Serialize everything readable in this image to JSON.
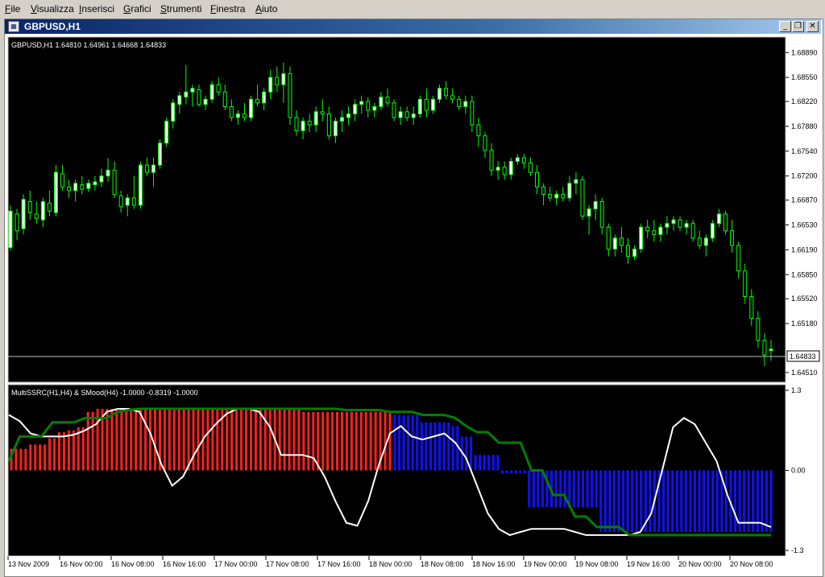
{
  "menu": [
    {
      "label": "File",
      "u": "F",
      "rest": "ile"
    },
    {
      "label": "Visualizza",
      "u": "V",
      "rest": "isualizza"
    },
    {
      "label": "Inserisci",
      "u": "I",
      "rest": "nserisci"
    },
    {
      "label": "Grafici",
      "u": "G",
      "rest": "rafici"
    },
    {
      "label": "Strumenti",
      "u": "S",
      "rest": "trumenti"
    },
    {
      "label": "Finestra",
      "u": "F",
      "rest": "inestra"
    },
    {
      "label": "Aiuto",
      "u": "A",
      "rest": "iuto"
    }
  ],
  "window": {
    "title": "GBPUSD,H1",
    "minimize": "_",
    "restore": "❐",
    "close": "✕"
  },
  "colors": {
    "bg": "#000000",
    "bull": "#ffffff",
    "wick": "#00ff00",
    "red": "#ff2020",
    "blue": "#1010ff",
    "line_white": "#ffffff",
    "line_green": "#008000",
    "axis_text": "#000000",
    "grid": "#c0c0c0"
  },
  "price_panel": {
    "header": "GBPUSD,H1  1.64810 1.64961 1.64668 1.64833",
    "current_price": "1.64833",
    "y_ticks": [
      "1.68890",
      "1.68550",
      "1.68220",
      "1.67880",
      "1.67540",
      "1.67200",
      "1.66870",
      "1.66530",
      "1.66190",
      "1.65850",
      "1.65520",
      "1.65180",
      "1.64510"
    ]
  },
  "indicator_panel": {
    "header": "MultiSSRC(H1,H4) & SMood(H4)  -1.0000 -0.8319 -1.0000",
    "y_ticks": [
      "1.3",
      "0.00",
      "-1.3"
    ]
  },
  "x_ticks": [
    "13 Nov 2009",
    "16 Nov 00:00",
    "16 Nov 08:00",
    "16 Nov 16:00",
    "17 Nov 00:00",
    "17 Nov 08:00",
    "17 Nov 16:00",
    "18 Nov 00:00",
    "18 Nov 08:00",
    "18 Nov 16:00",
    "19 Nov 00:00",
    "19 Nov 08:00",
    "19 Nov 16:00",
    "20 Nov 00:00",
    "20 Nov 08:00"
  ],
  "chart_data": {
    "type": "candlestick",
    "price_range": [
      1.6441,
      1.6897
    ],
    "candles": [
      {
        "o": 1.6622,
        "h": 1.668,
        "l": 1.6618,
        "c": 1.6672
      },
      {
        "o": 1.6668,
        "h": 1.6675,
        "l": 1.6632,
        "c": 1.6645
      },
      {
        "o": 1.6648,
        "h": 1.6695,
        "l": 1.664,
        "c": 1.6688
      },
      {
        "o": 1.6685,
        "h": 1.67,
        "l": 1.666,
        "c": 1.667
      },
      {
        "o": 1.6668,
        "h": 1.6685,
        "l": 1.6655,
        "c": 1.6662
      },
      {
        "o": 1.666,
        "h": 1.669,
        "l": 1.665,
        "c": 1.6685
      },
      {
        "o": 1.6683,
        "h": 1.67,
        "l": 1.6665,
        "c": 1.6672
      },
      {
        "o": 1.667,
        "h": 1.6735,
        "l": 1.6665,
        "c": 1.6725
      },
      {
        "o": 1.6723,
        "h": 1.6735,
        "l": 1.67,
        "c": 1.6705
      },
      {
        "o": 1.6705,
        "h": 1.6715,
        "l": 1.669,
        "c": 1.67
      },
      {
        "o": 1.67,
        "h": 1.6715,
        "l": 1.6685,
        "c": 1.671
      },
      {
        "o": 1.6708,
        "h": 1.672,
        "l": 1.6695,
        "c": 1.6702
      },
      {
        "o": 1.6703,
        "h": 1.6715,
        "l": 1.6698,
        "c": 1.671
      },
      {
        "o": 1.6708,
        "h": 1.672,
        "l": 1.67,
        "c": 1.6712
      },
      {
        "o": 1.6712,
        "h": 1.673,
        "l": 1.6705,
        "c": 1.672
      },
      {
        "o": 1.672,
        "h": 1.6745,
        "l": 1.6712,
        "c": 1.6728
      },
      {
        "o": 1.6728,
        "h": 1.674,
        "l": 1.669,
        "c": 1.6695
      },
      {
        "o": 1.6693,
        "h": 1.67,
        "l": 1.667,
        "c": 1.6678
      },
      {
        "o": 1.668,
        "h": 1.6695,
        "l": 1.6665,
        "c": 1.669
      },
      {
        "o": 1.669,
        "h": 1.672,
        "l": 1.6675,
        "c": 1.668
      },
      {
        "o": 1.668,
        "h": 1.674,
        "l": 1.6675,
        "c": 1.6735
      },
      {
        "o": 1.6735,
        "h": 1.6745,
        "l": 1.672,
        "c": 1.6725
      },
      {
        "o": 1.6725,
        "h": 1.6745,
        "l": 1.6705,
        "c": 1.6735
      },
      {
        "o": 1.6735,
        "h": 1.677,
        "l": 1.673,
        "c": 1.6765
      },
      {
        "o": 1.6765,
        "h": 1.68,
        "l": 1.676,
        "c": 1.6795
      },
      {
        "o": 1.6795,
        "h": 1.6825,
        "l": 1.6785,
        "c": 1.682
      },
      {
        "o": 1.6818,
        "h": 1.6835,
        "l": 1.6805,
        "c": 1.683
      },
      {
        "o": 1.6828,
        "h": 1.6872,
        "l": 1.6818,
        "c": 1.6835
      },
      {
        "o": 1.6835,
        "h": 1.6845,
        "l": 1.6815,
        "c": 1.684
      },
      {
        "o": 1.6838,
        "h": 1.6845,
        "l": 1.6815,
        "c": 1.6818
      },
      {
        "o": 1.6818,
        "h": 1.683,
        "l": 1.681,
        "c": 1.6825
      },
      {
        "o": 1.6825,
        "h": 1.685,
        "l": 1.682,
        "c": 1.6845
      },
      {
        "o": 1.6845,
        "h": 1.6855,
        "l": 1.683,
        "c": 1.6835
      },
      {
        "o": 1.6835,
        "h": 1.6845,
        "l": 1.681,
        "c": 1.6815
      },
      {
        "o": 1.6815,
        "h": 1.6825,
        "l": 1.6795,
        "c": 1.68
      },
      {
        "o": 1.68,
        "h": 1.681,
        "l": 1.679,
        "c": 1.6805
      },
      {
        "o": 1.6805,
        "h": 1.682,
        "l": 1.6795,
        "c": 1.68
      },
      {
        "o": 1.68,
        "h": 1.683,
        "l": 1.6795,
        "c": 1.6825
      },
      {
        "o": 1.6825,
        "h": 1.6845,
        "l": 1.6815,
        "c": 1.682
      },
      {
        "o": 1.682,
        "h": 1.684,
        "l": 1.681,
        "c": 1.6835
      },
      {
        "o": 1.6835,
        "h": 1.6865,
        "l": 1.6825,
        "c": 1.6855
      },
      {
        "o": 1.6855,
        "h": 1.687,
        "l": 1.6835,
        "c": 1.6845
      },
      {
        "o": 1.6845,
        "h": 1.6875,
        "l": 1.682,
        "c": 1.686
      },
      {
        "o": 1.686,
        "h": 1.687,
        "l": 1.679,
        "c": 1.68
      },
      {
        "o": 1.68,
        "h": 1.681,
        "l": 1.6775,
        "c": 1.6782
      },
      {
        "o": 1.6782,
        "h": 1.68,
        "l": 1.677,
        "c": 1.6795
      },
      {
        "o": 1.6795,
        "h": 1.6805,
        "l": 1.678,
        "c": 1.679
      },
      {
        "o": 1.679,
        "h": 1.6815,
        "l": 1.678,
        "c": 1.6808
      },
      {
        "o": 1.6808,
        "h": 1.6825,
        "l": 1.6795,
        "c": 1.6805
      },
      {
        "o": 1.6805,
        "h": 1.6815,
        "l": 1.677,
        "c": 1.6775
      },
      {
        "o": 1.6775,
        "h": 1.68,
        "l": 1.6765,
        "c": 1.6795
      },
      {
        "o": 1.6795,
        "h": 1.681,
        "l": 1.678,
        "c": 1.68
      },
      {
        "o": 1.68,
        "h": 1.6815,
        "l": 1.679,
        "c": 1.6805
      },
      {
        "o": 1.6805,
        "h": 1.6825,
        "l": 1.6795,
        "c": 1.6818
      },
      {
        "o": 1.6818,
        "h": 1.683,
        "l": 1.6805,
        "c": 1.6822
      },
      {
        "o": 1.6822,
        "h": 1.6828,
        "l": 1.68,
        "c": 1.681
      },
      {
        "o": 1.681,
        "h": 1.682,
        "l": 1.68,
        "c": 1.6815
      },
      {
        "o": 1.6815,
        "h": 1.6835,
        "l": 1.681,
        "c": 1.6828
      },
      {
        "o": 1.6828,
        "h": 1.684,
        "l": 1.6815,
        "c": 1.682
      },
      {
        "o": 1.682,
        "h": 1.6825,
        "l": 1.6795,
        "c": 1.68
      },
      {
        "o": 1.68,
        "h": 1.6815,
        "l": 1.679,
        "c": 1.6808
      },
      {
        "o": 1.6808,
        "h": 1.6815,
        "l": 1.6795,
        "c": 1.68
      },
      {
        "o": 1.68,
        "h": 1.6815,
        "l": 1.679,
        "c": 1.6805
      },
      {
        "o": 1.6805,
        "h": 1.683,
        "l": 1.68,
        "c": 1.6825
      },
      {
        "o": 1.6825,
        "h": 1.684,
        "l": 1.68,
        "c": 1.681
      },
      {
        "o": 1.681,
        "h": 1.683,
        "l": 1.6805,
        "c": 1.6825
      },
      {
        "o": 1.6825,
        "h": 1.6845,
        "l": 1.682,
        "c": 1.684
      },
      {
        "o": 1.684,
        "h": 1.685,
        "l": 1.6825,
        "c": 1.683
      },
      {
        "o": 1.683,
        "h": 1.684,
        "l": 1.682,
        "c": 1.6825
      },
      {
        "o": 1.6825,
        "h": 1.683,
        "l": 1.681,
        "c": 1.6815
      },
      {
        "o": 1.6815,
        "h": 1.683,
        "l": 1.6805,
        "c": 1.6822
      },
      {
        "o": 1.6822,
        "h": 1.683,
        "l": 1.678,
        "c": 1.679
      },
      {
        "o": 1.679,
        "h": 1.68,
        "l": 1.676,
        "c": 1.6775
      },
      {
        "o": 1.6775,
        "h": 1.678,
        "l": 1.6745,
        "c": 1.6755
      },
      {
        "o": 1.6755,
        "h": 1.6765,
        "l": 1.672,
        "c": 1.6728
      },
      {
        "o": 1.6728,
        "h": 1.674,
        "l": 1.6715,
        "c": 1.6732
      },
      {
        "o": 1.6732,
        "h": 1.674,
        "l": 1.6715,
        "c": 1.6722
      },
      {
        "o": 1.6722,
        "h": 1.6745,
        "l": 1.6715,
        "c": 1.674
      },
      {
        "o": 1.674,
        "h": 1.675,
        "l": 1.6735,
        "c": 1.6745
      },
      {
        "o": 1.6745,
        "h": 1.675,
        "l": 1.673,
        "c": 1.6738
      },
      {
        "o": 1.6738,
        "h": 1.6745,
        "l": 1.672,
        "c": 1.6725
      },
      {
        "o": 1.6725,
        "h": 1.6735,
        "l": 1.6695,
        "c": 1.6705
      },
      {
        "o": 1.6705,
        "h": 1.671,
        "l": 1.668,
        "c": 1.6695
      },
      {
        "o": 1.6695,
        "h": 1.6705,
        "l": 1.6685,
        "c": 1.669
      },
      {
        "o": 1.669,
        "h": 1.67,
        "l": 1.668,
        "c": 1.6695
      },
      {
        "o": 1.6695,
        "h": 1.6705,
        "l": 1.6685,
        "c": 1.669
      },
      {
        "o": 1.669,
        "h": 1.672,
        "l": 1.6685,
        "c": 1.671
      },
      {
        "o": 1.671,
        "h": 1.6725,
        "l": 1.6695,
        "c": 1.6715
      },
      {
        "o": 1.6715,
        "h": 1.672,
        "l": 1.666,
        "c": 1.6665
      },
      {
        "o": 1.6665,
        "h": 1.668,
        "l": 1.664,
        "c": 1.6675
      },
      {
        "o": 1.6675,
        "h": 1.6695,
        "l": 1.666,
        "c": 1.6685
      },
      {
        "o": 1.6685,
        "h": 1.669,
        "l": 1.664,
        "c": 1.665
      },
      {
        "o": 1.665,
        "h": 1.6655,
        "l": 1.661,
        "c": 1.662
      },
      {
        "o": 1.662,
        "h": 1.664,
        "l": 1.661,
        "c": 1.6635
      },
      {
        "o": 1.6635,
        "h": 1.665,
        "l": 1.6615,
        "c": 1.6625
      },
      {
        "o": 1.6625,
        "h": 1.6635,
        "l": 1.66,
        "c": 1.661
      },
      {
        "o": 1.661,
        "h": 1.6625,
        "l": 1.6605,
        "c": 1.662
      },
      {
        "o": 1.662,
        "h": 1.6655,
        "l": 1.6615,
        "c": 1.665
      },
      {
        "o": 1.665,
        "h": 1.666,
        "l": 1.6635,
        "c": 1.6645
      },
      {
        "o": 1.6645,
        "h": 1.666,
        "l": 1.663,
        "c": 1.664
      },
      {
        "o": 1.664,
        "h": 1.6655,
        "l": 1.663,
        "c": 1.665
      },
      {
        "o": 1.665,
        "h": 1.6665,
        "l": 1.664,
        "c": 1.6655
      },
      {
        "o": 1.6655,
        "h": 1.6665,
        "l": 1.6645,
        "c": 1.666
      },
      {
        "o": 1.666,
        "h": 1.6665,
        "l": 1.6645,
        "c": 1.665
      },
      {
        "o": 1.665,
        "h": 1.666,
        "l": 1.664,
        "c": 1.6655
      },
      {
        "o": 1.6655,
        "h": 1.666,
        "l": 1.663,
        "c": 1.6635
      },
      {
        "o": 1.6635,
        "h": 1.6645,
        "l": 1.662,
        "c": 1.6625
      },
      {
        "o": 1.6625,
        "h": 1.664,
        "l": 1.661,
        "c": 1.6635
      },
      {
        "o": 1.6635,
        "h": 1.666,
        "l": 1.663,
        "c": 1.6655
      },
      {
        "o": 1.6655,
        "h": 1.6675,
        "l": 1.665,
        "c": 1.6668
      },
      {
        "o": 1.6668,
        "h": 1.6672,
        "l": 1.664,
        "c": 1.6645
      },
      {
        "o": 1.6645,
        "h": 1.666,
        "l": 1.6615,
        "c": 1.6625
      },
      {
        "o": 1.6625,
        "h": 1.663,
        "l": 1.658,
        "c": 1.659
      },
      {
        "o": 1.659,
        "h": 1.66,
        "l": 1.6545,
        "c": 1.6555
      },
      {
        "o": 1.6555,
        "h": 1.6565,
        "l": 1.6515,
        "c": 1.6525
      },
      {
        "o": 1.6525,
        "h": 1.6535,
        "l": 1.6485,
        "c": 1.6495
      },
      {
        "o": 1.6495,
        "h": 1.6505,
        "l": 1.646,
        "c": 1.6475
      },
      {
        "o": 1.6481,
        "h": 1.6496,
        "l": 1.6467,
        "c": 1.6483
      }
    ],
    "indicator_range": [
      -1.3,
      1.3
    ],
    "indicator_histogram": [
      0.35,
      0.35,
      0.35,
      0.35,
      0.42,
      0.42,
      0.42,
      0.42,
      0.52,
      0.52,
      0.62,
      0.62,
      0.65,
      0.65,
      0.7,
      0.7,
      0.95,
      0.95,
      1.0,
      1.0,
      1.0,
      1.0,
      1.0,
      1.0,
      1.0,
      1.0,
      1.0,
      1.0,
      1.0,
      1.0,
      1.0,
      1.0,
      1.0,
      1.0,
      1.0,
      1.0,
      1.0,
      1.0,
      1.0,
      1.0,
      1.0,
      1.0,
      1.0,
      1.0,
      1.0,
      1.0,
      1.0,
      1.0,
      1.0,
      1.0,
      1.0,
      1.0,
      1.0,
      1.0,
      1.0,
      1.0,
      1.0,
      1.0,
      1.0,
      1.0,
      1.0,
      0.95,
      0.95,
      0.95,
      0.95,
      0.95,
      0.95,
      0.95,
      0.95,
      0.95,
      0.95,
      0.95,
      0.95,
      0.95,
      0.95,
      0.95,
      0.95,
      0.95,
      0.95,
      0.95,
      0.95,
      0.95,
      0.95,
      0.95,
      0.95,
      0.95,
      0.95,
      0.95,
      0.95,
      0.95,
      0.95,
      0.95,
      0.95,
      0.95,
      0.95,
      0.95,
      0.95,
      0.95,
      0.95,
      0.95,
      0.95,
      0.95,
      0.95,
      0.95,
      0.95,
      0.95,
      0.95,
      0.95,
      0.95,
      0.95,
      0.95,
      0.95,
      0.95,
      0.95,
      0.95,
      0.95,
      0.95,
      0.95,
      0.95,
      0.95,
      0.95,
      0.95,
      0.95,
      0.95,
      0.95
    ],
    "indicator_colors": [
      "r",
      "r",
      "r",
      "r",
      "r",
      "r",
      "r",
      "r",
      "r",
      "r",
      "r",
      "r",
      "r",
      "r",
      "r",
      "r",
      "r",
      "r",
      "r",
      "r",
      "r",
      "r",
      "r",
      "r",
      "r",
      "r",
      "r",
      "r",
      "r",
      "r",
      "r",
      "r",
      "r",
      "r",
      "r",
      "r",
      "r",
      "r",
      "r",
      "r",
      "r",
      "r",
      "r",
      "r",
      "r",
      "r",
      "r",
      "r",
      "r",
      "r",
      "r",
      "r",
      "r",
      "r",
      "r",
      "r",
      "r",
      "r",
      "r",
      "r",
      "r",
      "r",
      "r",
      "r",
      "r",
      "r",
      "r",
      "r",
      "r",
      "r",
      "r",
      "r",
      "r",
      "r",
      "r",
      "r",
      "r",
      "r",
      "r",
      "r",
      "r",
      "r",
      "r",
      "r",
      "r",
      "r",
      "r",
      "r",
      "r",
      "r",
      "r",
      "r",
      "r",
      "r",
      "r",
      "r",
      "r",
      "r",
      "r",
      "r",
      "r",
      "r",
      "r",
      "r",
      "r",
      "r",
      "r",
      "r",
      "r",
      "r",
      "r",
      "r",
      "r",
      "r",
      "r",
      "r",
      "r",
      "r",
      "r",
      "r",
      "r"
    ],
    "blue_histogram": [
      0.9,
      0.9,
      0.9,
      0.9,
      0.9,
      0.9,
      0.78,
      0.78,
      0.78,
      0.78,
      0.78,
      0.78,
      0.78,
      0.72,
      0.72,
      0.55,
      0.55,
      0.55,
      0.25,
      0.25,
      0.25,
      0.25,
      0.25,
      0.25,
      -0.05,
      -0.05,
      -0.05,
      -0.05,
      -0.05,
      -0.05,
      -0.6,
      -0.6,
      -0.6,
      -0.6,
      -0.6,
      -0.6,
      -0.6,
      -0.6,
      -0.6,
      -0.6,
      -0.6,
      -0.6,
      -0.6,
      -0.6,
      -0.6,
      -0.6,
      -1.0,
      -1.0,
      -1.0,
      -1.0,
      -1.0,
      -1.0,
      -1.0,
      -1.0,
      -1.0,
      -1.0,
      -1.0,
      -1.0,
      -1.0,
      -1.0,
      -1.0,
      -1.0,
      -1.0,
      -1.0,
      -1.0,
      -1.0,
      -1.0,
      -1.0,
      -1.0,
      -1.0,
      -1.0,
      -1.0,
      -1.0,
      -1.0,
      -1.0,
      -1.0,
      -1.0,
      -1.0,
      -1.0,
      -1.0,
      -1.0,
      -1.0,
      -1.0,
      -1.0,
      -1.0
    ],
    "white_line": [
      0.9,
      0.8,
      0.6,
      0.55,
      0.55,
      0.55,
      0.58,
      0.65,
      0.75,
      0.95,
      1.0,
      1.0,
      0.95,
      0.6,
      0.1,
      -0.25,
      -0.1,
      0.25,
      0.55,
      0.75,
      0.92,
      1.0,
      1.0,
      0.95,
      0.7,
      0.25,
      0.25,
      0.25,
      0.2,
      -0.1,
      -0.5,
      -0.85,
      -0.9,
      -0.5,
      0.1,
      0.6,
      0.72,
      0.55,
      0.5,
      0.55,
      0.6,
      0.45,
      0.2,
      -0.25,
      -0.7,
      -0.95,
      -1.05,
      -1.0,
      -0.95,
      -0.95,
      -0.95,
      -0.95,
      -1.0,
      -1.05,
      -1.05,
      -1.05,
      -1.05,
      -1.05,
      -1.0,
      -0.7,
      0.0,
      0.7,
      0.85,
      0.75,
      0.45,
      0.15,
      -0.4,
      -0.85,
      -0.85,
      -0.85,
      -0.92
    ],
    "green_line": [
      0.15,
      0.55,
      0.55,
      0.55,
      0.78,
      0.78,
      0.78,
      0.85,
      0.85,
      0.85,
      0.95,
      0.98,
      1.0,
      1.0,
      1.0,
      1.0,
      1.0,
      1.0,
      1.0,
      1.0,
      1.0,
      1.0,
      1.0,
      1.0,
      1.0,
      1.0,
      1.0,
      1.0,
      1.0,
      1.0,
      1.0,
      0.98,
      0.98,
      0.98,
      0.98,
      0.95,
      0.95,
      0.95,
      0.9,
      0.9,
      0.9,
      0.85,
      0.72,
      0.62,
      0.62,
      0.45,
      0.45,
      0.45,
      0.0,
      0.0,
      -0.4,
      -0.4,
      -0.75,
      -0.75,
      -0.92,
      -0.92,
      -0.92,
      -1.05,
      -1.05,
      -1.05,
      -1.05,
      -1.05,
      -1.05,
      -1.05,
      -1.05,
      -1.05,
      -1.05,
      -1.05,
      -1.05,
      -1.05,
      -1.05
    ]
  }
}
